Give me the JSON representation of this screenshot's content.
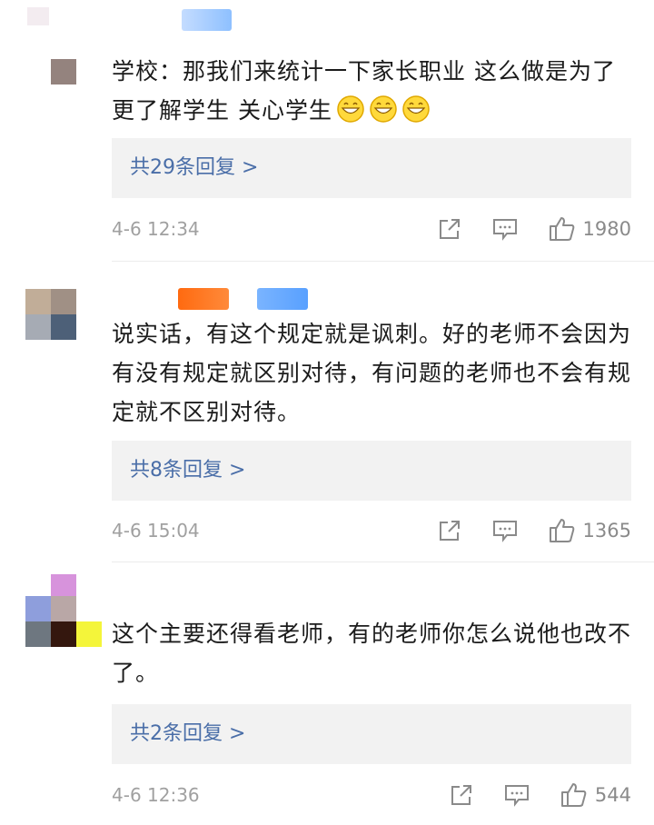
{
  "comments": [
    {
      "text": "学校：那我们来统计一下家长职业 这么做是为了更了解学生 关心学生",
      "emoji_icon": "grinning-face-icon",
      "replies_label": "共29条回复 >",
      "time": "4-6 12:34",
      "likes": "1980"
    },
    {
      "text": "说实话，有这个规定就是讽刺。好的老师不会因为有没有规定就区别对待，有问题的老师也不会有规定就不区别对待。",
      "replies_label": "共8条回复 >",
      "time": "4-6 15:04",
      "likes": "1365"
    },
    {
      "text": "这个主要还得看老师，有的老师你怎么说他也改不了。",
      "replies_label": "共2条回复 >",
      "time": "4-6 12:36",
      "likes": "544"
    }
  ],
  "icons": {
    "share": "share-icon",
    "comment": "comment-icon",
    "like": "thumbs-up-icon"
  },
  "colors": {
    "link": "#4a6ea8",
    "reply_bg": "#f2f2f2",
    "meta": "#a0a0a0"
  }
}
